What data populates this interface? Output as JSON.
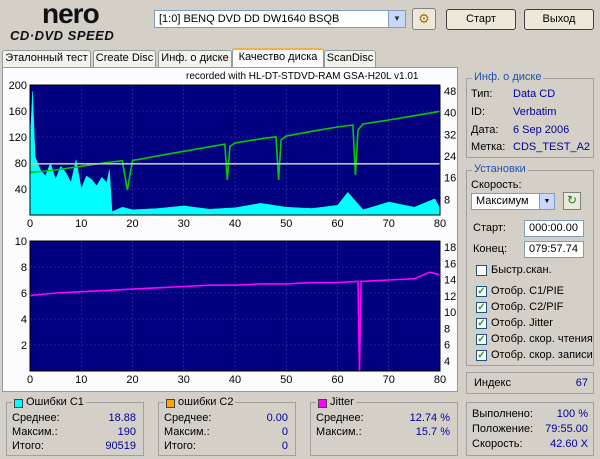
{
  "app": {
    "logo_top": "nero",
    "logo_bottom": "CD·DVD SPEED"
  },
  "toolbar": {
    "drive_selected": "[1:0]  BENQ DVD DD DW1640 BSQB",
    "start_label": "Старт",
    "exit_label": "Выход"
  },
  "tabs": [
    {
      "label": "Эталонный тест"
    },
    {
      "label": "Create Disc"
    },
    {
      "label": "Инф. о диске"
    },
    {
      "label": "Качество диска"
    },
    {
      "label": "ScanDisc"
    }
  ],
  "active_tab": "Качество диска",
  "recorder_caption": "recorded with HL-DT-STDVD-RAM GSA-H20L v1.01",
  "disc_info": {
    "title": "Инф. о диске",
    "type_label": "Тип:",
    "type_value": "Data CD",
    "id_label": "ID:",
    "id_value": "Verbatim",
    "date_label": "Дата:",
    "date_value": "6 Sep 2006",
    "mark_label": "Метка:",
    "mark_value": "CDS_TEST_A2"
  },
  "settings": {
    "title": "Установки",
    "speed_label": "Скорость:",
    "speed_value": "Максимум",
    "start_label": "Старт:",
    "start_value": "000:00.00",
    "end_label": "Конец:",
    "end_value": "079:57.74",
    "quick_scan_label": "Быстр.скан.",
    "checks": [
      {
        "label": "Отобр. C1/PIE",
        "checked": true
      },
      {
        "label": "Отобр. C2/PIF",
        "checked": true
      },
      {
        "label": "Отобр. Jitter",
        "checked": true
      },
      {
        "label": "Отобр. скор. чтения",
        "checked": true
      },
      {
        "label": "Отобр. скор. записи",
        "checked": true
      }
    ]
  },
  "index": {
    "label": "Индекс",
    "value": "67"
  },
  "stats": {
    "c1": {
      "title": "Ошибки C1",
      "color": "#00ffff",
      "avg_label": "Среднее:",
      "avg": "18.88",
      "max_label": "Максим.:",
      "max": "190",
      "total_label": "Итого:",
      "total": "90519"
    },
    "c2": {
      "title": "ошибки C2",
      "color": "#ffa500",
      "avg_label": "Средчее:",
      "avg": "0.00",
      "max_label": "Максим.:",
      "max": "0",
      "total_label": "Итого:",
      "total": "0"
    },
    "jitter": {
      "title": "Jitter",
      "color": "#ff00ff",
      "avg_label": "Среднее:",
      "avg": "12.74 %",
      "max_label": "Максим.:",
      "max": "15.7 %"
    }
  },
  "progress": {
    "done_label": "Выполнено:",
    "done_value": "100 %",
    "pos_label": "Положение:",
    "pos_value": "79:55.00",
    "speed_label": "Скорость:",
    "speed_value": "42.60 X"
  },
  "chart_data": [
    {
      "type": "area",
      "name": "errors",
      "x_ticks": [
        "0",
        "10",
        "20",
        "30",
        "40",
        "50",
        "60",
        "70",
        "80"
      ],
      "y_left_ticks": [
        "200",
        "160",
        "120",
        "80",
        "40"
      ],
      "y_right_ticks": [
        "48",
        "40",
        "32",
        "24",
        "16",
        "8"
      ],
      "xlim": [
        0,
        80
      ],
      "ylim_left": [
        0,
        200
      ],
      "ylim_right": [
        0,
        52
      ],
      "series": [
        {
          "color": "#00ffff",
          "x": [
            0,
            0.5,
            1,
            2,
            3,
            4,
            5,
            6,
            7,
            8,
            9,
            10,
            11,
            12,
            13,
            14,
            15,
            15.5,
            16,
            18,
            20,
            25,
            30,
            35,
            40,
            45,
            50,
            55,
            60,
            62,
            65,
            70,
            75,
            79,
            80
          ],
          "y": [
            110,
            190,
            90,
            70,
            60,
            80,
            55,
            75,
            65,
            50,
            85,
            40,
            60,
            55,
            45,
            58,
            50,
            70,
            5,
            12,
            8,
            10,
            14,
            9,
            11,
            18,
            12,
            10,
            15,
            35,
            8,
            20,
            12,
            25,
            10
          ]
        },
        {
          "color": "#00cc00",
          "x": [
            0,
            5,
            10,
            15,
            18,
            19,
            20,
            22,
            25,
            30,
            35,
            38,
            38.5,
            39,
            40,
            45,
            48,
            48.5,
            49,
            50,
            55,
            60,
            63,
            63.5,
            64,
            65,
            70,
            75,
            80
          ],
          "y": [
            17,
            18,
            19.5,
            21,
            21.7,
            10,
            21.9,
            22.5,
            23.7,
            25.5,
            27.3,
            28.3,
            14,
            27.5,
            28.8,
            30.5,
            31.3,
            14,
            30,
            31.6,
            33.5,
            35.2,
            36,
            16,
            34,
            36.4,
            38,
            39.7,
            41.5
          ]
        },
        {
          "color": "#c0c0c0",
          "x": [
            0,
            80
          ],
          "y": [
            20.5,
            20.5
          ]
        }
      ]
    },
    {
      "type": "line",
      "name": "jitter",
      "x_ticks": [
        "0",
        "10",
        "20",
        "30",
        "40",
        "50",
        "60",
        "70",
        "80"
      ],
      "y_left_ticks": [
        "10",
        "8",
        "6",
        "4",
        "2"
      ],
      "y_right_ticks": [
        "18",
        "16",
        "14",
        "12",
        "10",
        "8",
        "6",
        "4"
      ],
      "xlim": [
        0,
        80
      ],
      "ylim_left": [
        0,
        10
      ],
      "series": [
        {
          "color": "#ff00ff",
          "x": [
            0,
            5,
            10,
            15,
            20,
            25,
            30,
            35,
            40,
            45,
            50,
            55,
            60,
            64,
            64.3,
            64.6,
            65,
            70,
            75,
            78,
            80
          ],
          "y": [
            5.8,
            6.0,
            6.1,
            6.2,
            6.3,
            6.4,
            6.5,
            6.6,
            6.6,
            6.7,
            6.7,
            6.8,
            6.8,
            6.9,
            0,
            6.9,
            6.9,
            7.0,
            7.1,
            7.6,
            7.4
          ]
        }
      ]
    }
  ]
}
